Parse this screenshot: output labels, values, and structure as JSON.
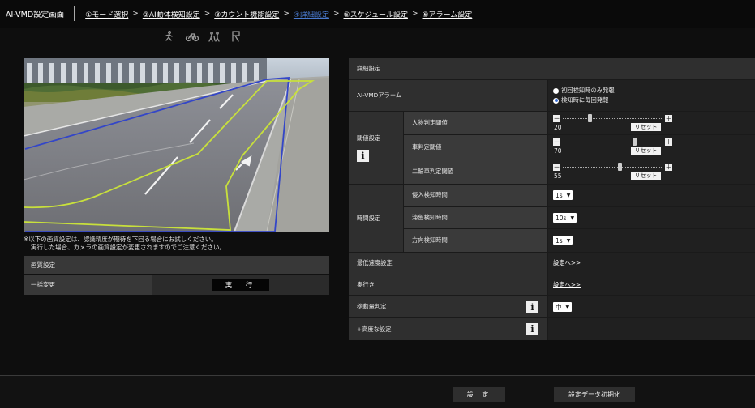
{
  "header": {
    "title": "AI-VMD設定画面",
    "crumbs": [
      {
        "label": "①モード選択",
        "active": false
      },
      {
        "label": "②AI動体検知設定",
        "active": false
      },
      {
        "label": "③カウント機能設定",
        "active": false
      },
      {
        "label": "④詳細設定",
        "active": true
      },
      {
        "label": "⑤スケジュール設定",
        "active": false
      },
      {
        "label": "⑥アラーム設定",
        "active": false
      }
    ],
    "arrow": ">"
  },
  "icons": [
    "person-walk-icon",
    "bicycle-icon",
    "crowd-icon",
    "flag-icon"
  ],
  "note": {
    "line1": "※以下の画質設定は、認識精度が期待を下回る場合にお試しください。",
    "line2": "実行した場合、カメラの画質設定が変更されますのでご注意ください。"
  },
  "image_settings": {
    "header": "画質設定",
    "row_label": "一括変更",
    "exec_button": "実　行"
  },
  "settings": {
    "detail_header": "詳細設定",
    "alarm": {
      "label": "AI-VMDアラーム",
      "options": [
        "初回検知時のみ発報",
        "検知時に毎回発報"
      ],
      "selected": 1
    },
    "threshold": {
      "label": "閾値設定",
      "rows": [
        {
          "label": "人物判定閾値",
          "value": 20
        },
        {
          "label": "車判定閾値",
          "value": 70
        },
        {
          "label": "二輪車判定閾値",
          "value": 55
        }
      ],
      "reset": "リセット",
      "minus": "－",
      "plus": "＋"
    },
    "time": {
      "label": "時間設定",
      "rows": [
        {
          "label": "侵入検知時間",
          "value": "1s"
        },
        {
          "label": "滞留検知時間",
          "value": "10s"
        },
        {
          "label": "方向検知時間",
          "value": "1s"
        }
      ]
    },
    "min_speed": {
      "label": "最低速度設定",
      "link": "設定へ>>"
    },
    "depth": {
      "label": "奥行き",
      "link": "設定へ>>"
    },
    "movement": {
      "label": "移動量判定",
      "value": "中"
    },
    "advanced": {
      "label": "+高度な設定"
    }
  },
  "footer": {
    "set_button": "設 定",
    "init_button": "設定データ初期化"
  },
  "colors": {
    "active_crumb": "#4a7bd0",
    "detection_area": "#c8e03c",
    "road_edge": "#3346c8"
  }
}
